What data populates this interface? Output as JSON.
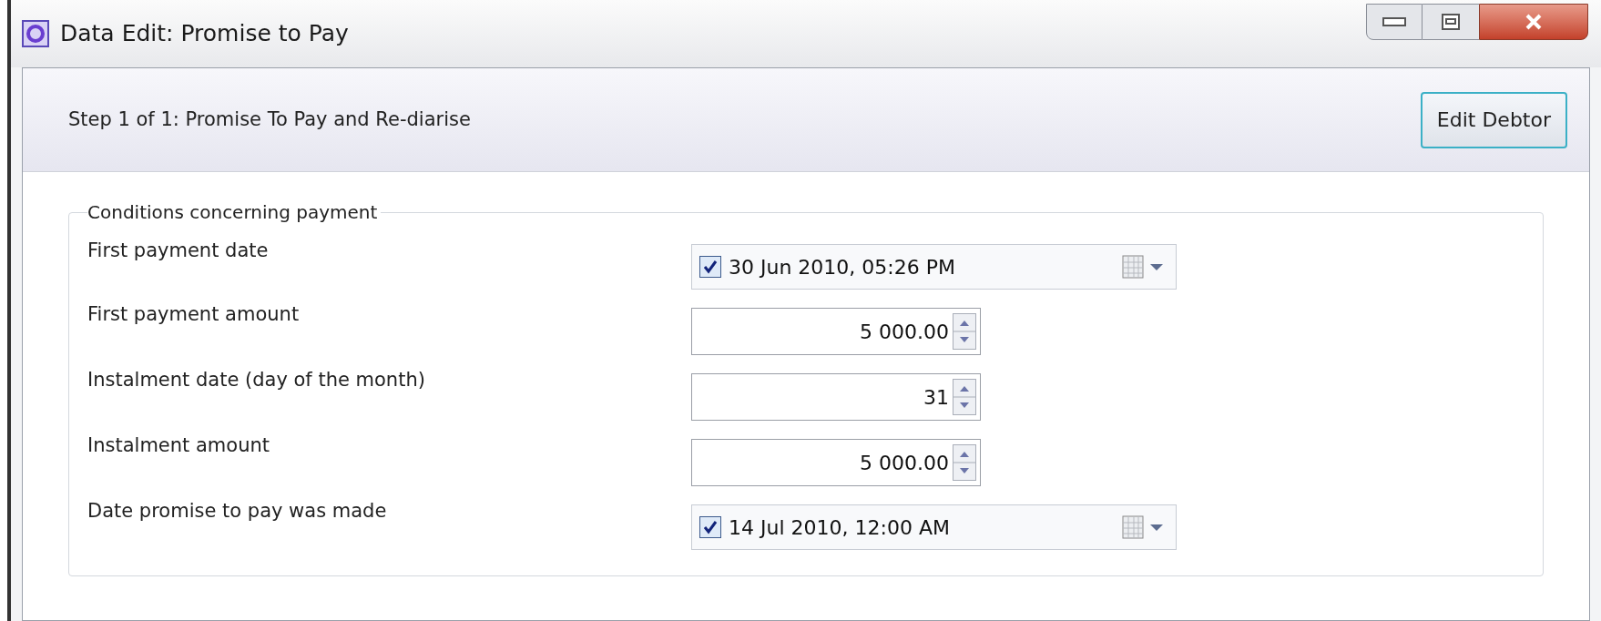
{
  "window": {
    "title": "Data Edit:  Promise to Pay"
  },
  "header": {
    "step": "Step 1 of 1:  Promise To Pay and Re-diarise",
    "button": "Edit Debtor"
  },
  "group": {
    "title": "Conditions concerning payment",
    "fields": [
      {
        "label": "First payment date",
        "kind": "date",
        "checked": true,
        "value": "30 Jun  2010, 05:26 PM"
      },
      {
        "label": "First payment amount",
        "kind": "number",
        "value": "5 000.00"
      },
      {
        "label": "Instalment date (day of the month)",
        "kind": "number",
        "value": "31"
      },
      {
        "label": "Instalment amount",
        "kind": "number",
        "value": "5 000.00"
      },
      {
        "label": "Date promise to pay was made",
        "kind": "date",
        "checked": true,
        "value": "14 Jul  2010, 12:00 AM"
      }
    ]
  }
}
